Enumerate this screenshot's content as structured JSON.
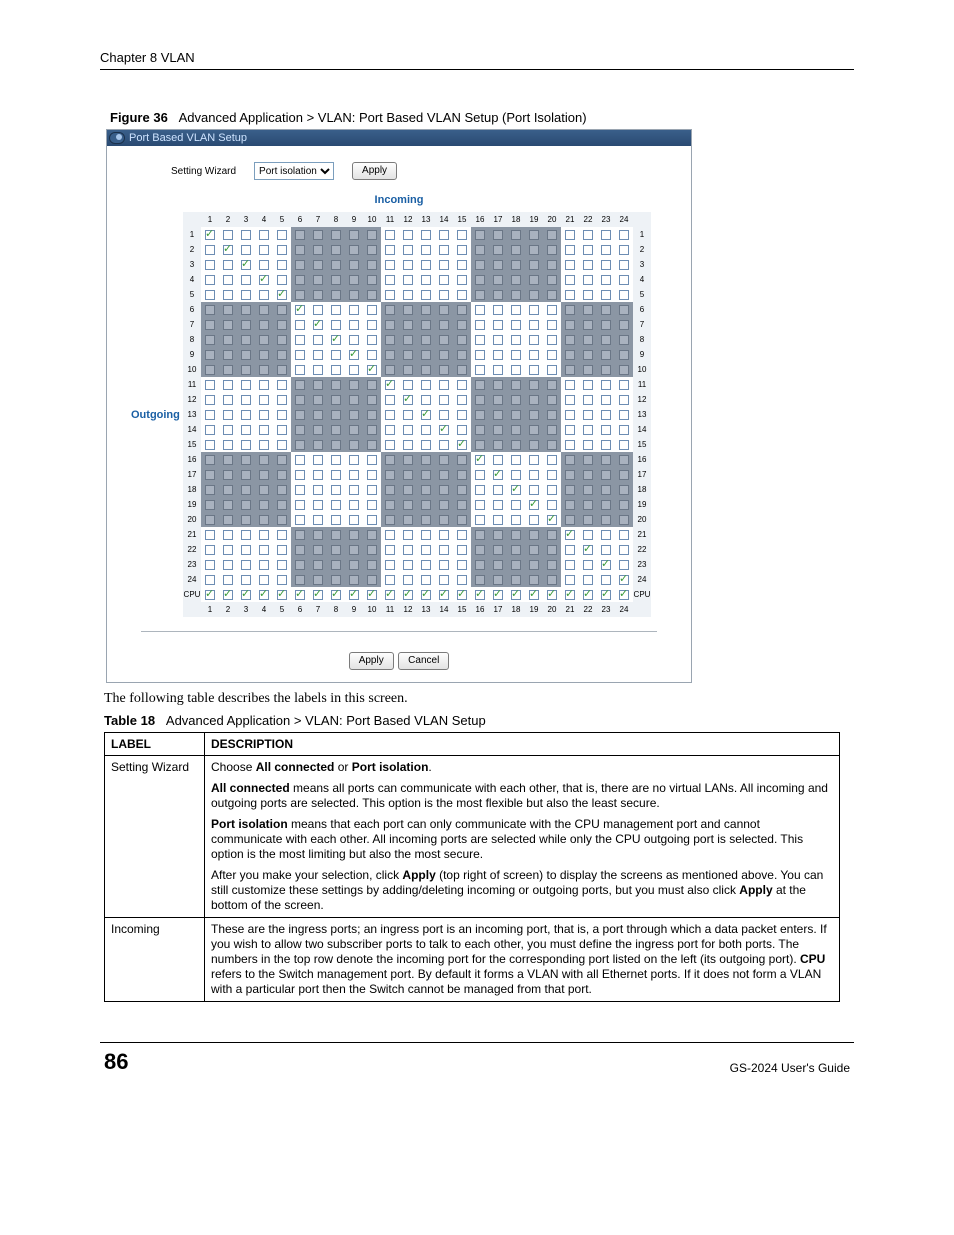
{
  "chapter": "Chapter 8 VLAN",
  "figure": {
    "label": "Figure 36",
    "title": "Advanced Application > VLAN: Port Based VLAN Setup (Port Isolation)"
  },
  "panel": {
    "title": "Port Based VLAN Setup",
    "wizard_label": "Setting Wizard",
    "wizard_value": "Port isolation",
    "apply": "Apply",
    "incoming": "Incoming",
    "outgoing": "Outgoing",
    "cancel": "Cancel",
    "port_count": 24,
    "cpu_label": "CPU"
  },
  "intro_text": "The following table describes the labels in this screen.",
  "table_caption": {
    "label": "Table 18",
    "title": "Advanced Application > VLAN: Port Based VLAN Setup"
  },
  "doc_table": {
    "hdr_label": "LABEL",
    "hdr_desc": "DESCRIPTION",
    "rows": [
      {
        "label": "Setting Wizard",
        "desc": [
          "Choose <b>All connected</b> or <b>Port isolation</b>.",
          "<b>All connected</b> means all ports can communicate with each other, that is, there are no virtual LANs. All incoming and outgoing ports are selected. This option is the most flexible but also the least secure.",
          "<b>Port isolation</b> means that each port can only communicate with the CPU management port and cannot communicate with each other. All incoming ports are selected while only the CPU outgoing port is selected. This option is the most limiting but also the most secure.",
          "After you make your selection, click <b>Apply</b> (top right of screen) to display the screens as mentioned above. You can still customize these settings by adding/deleting incoming or outgoing ports, but you must also click <b>Apply</b> at the bottom of the screen."
        ]
      },
      {
        "label": "Incoming",
        "desc": [
          "These are the ingress ports; an ingress port is an incoming port, that is, a port through which a data packet enters. If you wish to allow two subscriber ports to talk to each other, you must define the ingress port for both ports. The numbers in the top row denote the incoming port for the corresponding port listed on the left (its outgoing port). <b>CPU</b> refers to the Switch management port. By default it forms a VLAN with all Ethernet ports. If it does not form a VLAN with a particular port then the Switch cannot be managed from that port."
        ]
      }
    ]
  },
  "footer": {
    "page": "86",
    "guide": "GS-2024 User's Guide"
  }
}
